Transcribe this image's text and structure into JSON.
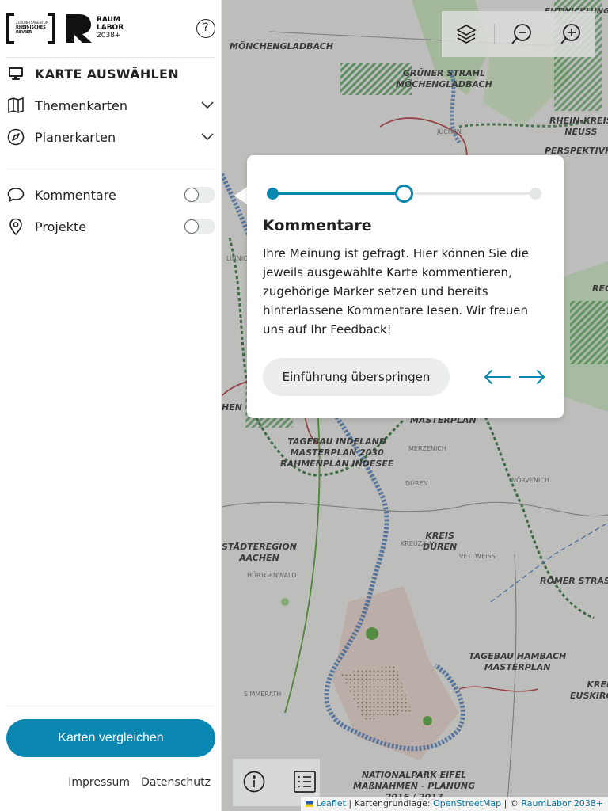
{
  "brand": {
    "logo_left_lines": [
      "ZUKUNFTSAGENTUR",
      "RHEINISCHES",
      "REVIER"
    ],
    "logo_right_lines": [
      "RAUM",
      "LABOR",
      "2038+"
    ]
  },
  "sidebar": {
    "select_map_label": "KARTE AUSWÄHLEN",
    "items": [
      {
        "label": "Themenkarten",
        "icon": "map-icon"
      },
      {
        "label": "Planerkarten",
        "icon": "compass-icon"
      }
    ],
    "toggles": [
      {
        "label": "Kommentare",
        "icon": "comment-icon",
        "on": false
      },
      {
        "label": "Projekte",
        "icon": "location-pin-icon",
        "on": false
      }
    ],
    "compare_button": "Karten vergleichen",
    "footer": {
      "impressum": "Impressum",
      "datenschutz": "Datenschutz"
    }
  },
  "map": {
    "labels": {
      "moenchengladbach": "MÖNCHENGLADBACH",
      "gruener_strahl": "GRÜNER STRAHL\nMÖCHENGLADBACH",
      "rhein_kreis": "RHEIN-KREIS\nNEUSS",
      "perspektiv": "PERSPEKTIVKOZEPT",
      "reg": "REG",
      "hen": "HEN",
      "masterplan": "MASTERPLAN",
      "indeland": "TAGEBAU INDELAND\nMASTERPLAN 2030\nRAHMENPLAN INDESEE",
      "kreis_dueren": "KREIS\nDÜREN",
      "staedteregion": "STÄDTEREGION\nAACHEN",
      "roemer": "RÖMER STRASSE",
      "hambach": "TAGEBAU HAMBACH\nMASTERPLAN",
      "kreis_euskirchen": "KREIS\nEUSKIRCHEN",
      "nationalpark": "NATIONALPARK EIFEL\nMAßNAHMEN - PLANUNG\n2016 / 2017",
      "dueren_town": "DÜREN",
      "merzenich": "MERZENICH",
      "norvenich": "NÖRVENICH",
      "huertgenwald": "HÜRTGENWALD",
      "linnich": "LINNICH",
      "simmerath": "SIMMERATH",
      "vettweiss": "VETTWEISS",
      "kreuzau": "KREUZAU",
      "juechen": "JÜCHEN",
      "top_right_label": "ENTWICKLUNG"
    },
    "attribution": {
      "leaflet": "Leaflet",
      "sep1": " | Kartengrundlage: ",
      "osm": "OpenStreetMap",
      "sep2": " | © ",
      "raumlabor": "RaumLabor 2038+"
    }
  },
  "popover": {
    "title": "Kommentare",
    "body": "Ihre Meinung ist gefragt. Hier können Sie die jeweils ausgewählte Karte kommentieren, zugehörige Marker setzen und bereits hinterlassene Kommentare lesen. Wir freuen uns auf Ihr Feedback!",
    "skip_button": "Einführung überspringen",
    "step_progress": 0.5
  },
  "colors": {
    "accent": "#0a87b0",
    "track": "#e3e6e6"
  }
}
